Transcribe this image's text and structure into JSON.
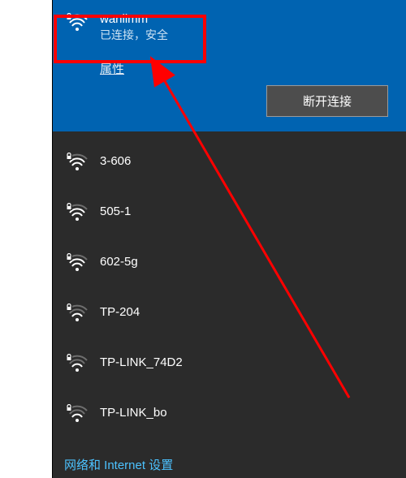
{
  "active": {
    "name": "wanlimm",
    "status": "已连接，安全",
    "properties_label": "属性",
    "disconnect_label": "断开连接"
  },
  "networks": [
    {
      "name": "3-606",
      "signal": 3,
      "secured": true
    },
    {
      "name": "505-1",
      "signal": 3,
      "secured": true
    },
    {
      "name": "602-5g",
      "signal": 3,
      "secured": true
    },
    {
      "name": "TP-204",
      "signal": 2,
      "secured": true
    },
    {
      "name": "TP-LINK_74D2",
      "signal": 2,
      "secured": true
    },
    {
      "name": "TP-LINK_bo",
      "signal": 2,
      "secured": true
    }
  ],
  "settings_link": "网络和 Internet 设置"
}
